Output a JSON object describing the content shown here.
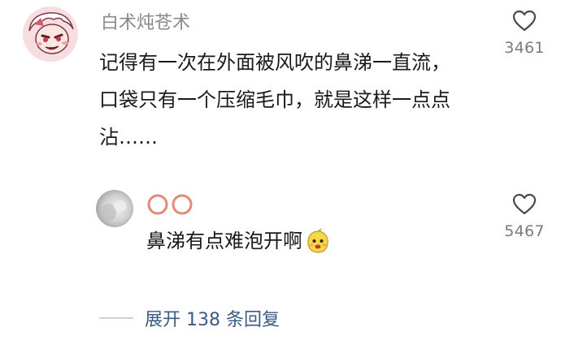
{
  "comments": [
    {
      "username": "白术炖苍术",
      "lines": [
        "记得有一次在外面被风吹的鼻涕一直流，",
        "口袋只有一个压缩毛巾，就是这样一点点",
        "沾……"
      ],
      "like_count": "3461",
      "avatar_icon": "anime-character-avatar-icon"
    },
    {
      "username_icon": "double-orange-circles-icon",
      "text": "鼻涕有点难泡开啊",
      "emoji": "mango-face-emoji-icon",
      "like_count": "5467",
      "avatar_icon": "gray-blurry-avatar-icon"
    }
  ],
  "replies": {
    "expand_label": "展开 138 条回复"
  },
  "colors": {
    "username": "#8a8a8a",
    "text": "#1a1a1a",
    "like_count": "#7a7a7a",
    "expand_link": "#3b5b85"
  }
}
